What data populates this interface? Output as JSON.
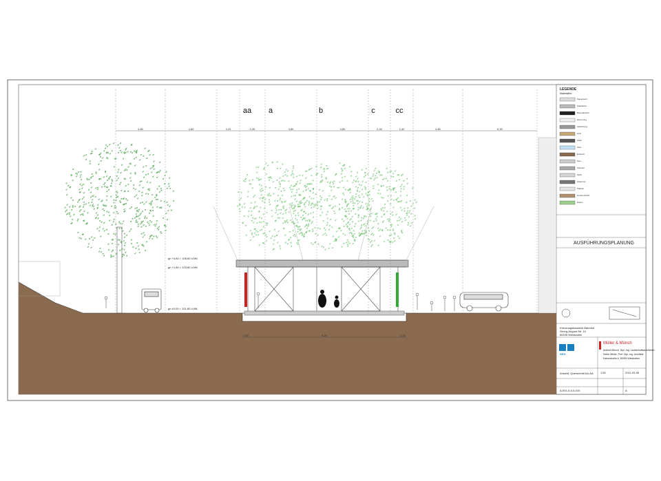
{
  "drawing": {
    "axes": [
      "aa",
      "a",
      "b",
      "c",
      "cc"
    ],
    "top_dimensions": [
      "4,80",
      "4,80",
      "2,41",
      "2,39",
      "4,80",
      "4,80",
      "2,40",
      "2,40",
      "4,80",
      "6,30"
    ],
    "bottom_dimensions": [
      "0,45",
      "8,25",
      "0,45"
    ],
    "level_labels": [
      "gn +4,80 = 106,60 ü.NN",
      "gn +1,80 = 103,60 ü.NN",
      "gn ±0,00 = 101,80 ü.NN"
    ]
  },
  "legend": {
    "title": "LEGENDE",
    "subtitle": "Materialien:",
    "items": [
      "Mauerwerk",
      "Stahlbeton",
      "Beton/Estrich",
      "Dämmung",
      "Abdichtung",
      "Holz",
      "Stahl",
      "Glas",
      "Erdreich",
      "Kies",
      "Schotter",
      "Splitt",
      "Gitterrost",
      "Pflaster",
      "Holzwerkstoff",
      "Rasen"
    ]
  },
  "titleblock": {
    "phase": "AUSFÜHRUNGSPLANUNG",
    "architect_name": "Müller & Münch",
    "architect_lines": [
      "Andrea Münch, Dipl.-Ing. Landschaftsarchitektin",
      "Dieter Müller, Prof. Dipl.-Ing. Architekt",
      "Kaiserstraße 6, 65185 Wiesbaden"
    ],
    "project_lines": [
      "Kreuzungsbauwerk Bahnhof",
      "Georg-August-Str. 10",
      "65195 Wiesbaden"
    ],
    "plan_title": "Ansicht, Querschnitt AA-AA",
    "scale": "1:50",
    "date": "2011-03-06",
    "plan_no": "A-001-5-0-5-010",
    "index": "A",
    "client_logo": "SEG"
  },
  "colors": {
    "ground": "#8a6b50",
    "tree": "#3f9a3f",
    "tree_light": "#6cc06c",
    "steel": "#555555",
    "red": "#cc2222",
    "green": "#33aa33"
  }
}
